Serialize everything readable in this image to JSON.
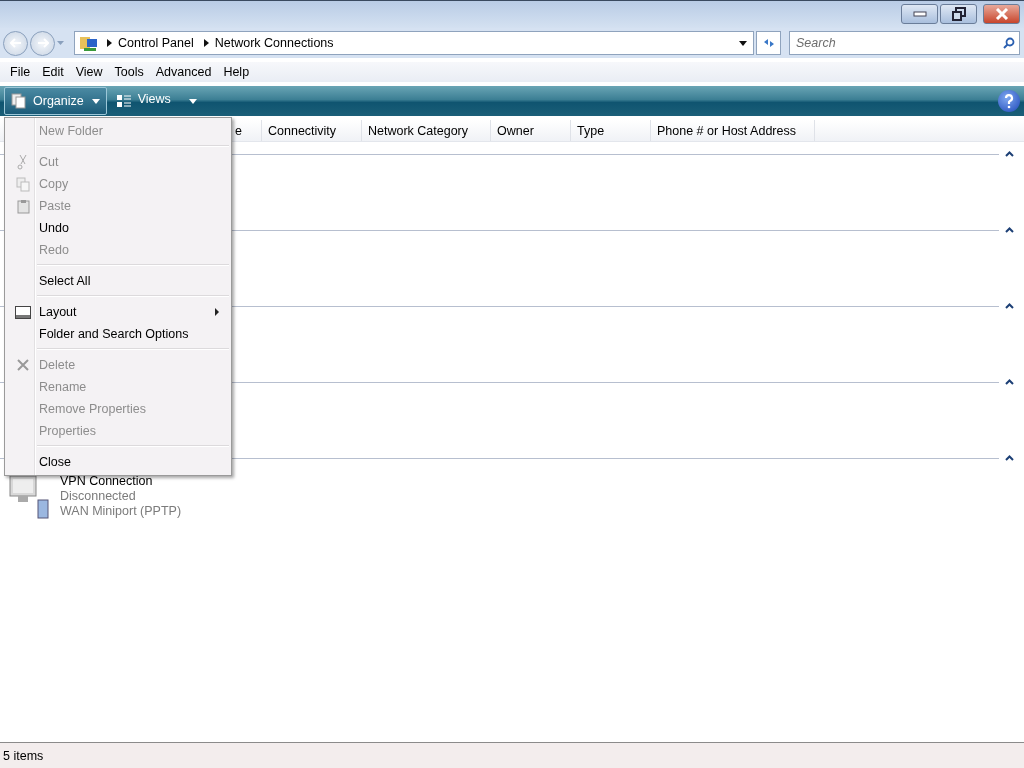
{
  "address": {
    "crumbs": [
      "Control Panel",
      "Network Connections"
    ]
  },
  "search": {
    "placeholder": "Search"
  },
  "menu_bar": [
    "File",
    "Edit",
    "View",
    "Tools",
    "Advanced",
    "Help"
  ],
  "toolbar": {
    "buttons": [
      {
        "label": "Organize",
        "selected": true
      },
      {
        "label": "Views",
        "selected": false
      }
    ]
  },
  "columns": [
    "e",
    "Connectivity",
    "Network Category",
    "Owner",
    "Type",
    "Phone # or Host Address"
  ],
  "groups": [
    {
      "expanded": true
    },
    {
      "expanded": true
    },
    {
      "expanded": true
    },
    {
      "expanded": true
    },
    {
      "expanded": true,
      "items": [
        {
          "name": "VPN Connection",
          "status": "Disconnected",
          "device": "WAN Miniport (PPTP)"
        }
      ]
    }
  ],
  "organize_menu": [
    {
      "kind": "item",
      "label": "New Folder",
      "disabled": true
    },
    {
      "kind": "separator"
    },
    {
      "kind": "item",
      "label": "Cut",
      "disabled": true
    },
    {
      "kind": "item",
      "label": "Copy",
      "disabled": true
    },
    {
      "kind": "item",
      "label": "Paste",
      "disabled": true
    },
    {
      "kind": "item",
      "label": "Undo",
      "disabled": false
    },
    {
      "kind": "item",
      "label": "Redo",
      "disabled": true
    },
    {
      "kind": "separator"
    },
    {
      "kind": "item",
      "label": "Select All",
      "disabled": false
    },
    {
      "kind": "separator"
    },
    {
      "kind": "submenu",
      "label": "Layout",
      "disabled": false
    },
    {
      "kind": "item",
      "label": "Folder and Search Options",
      "disabled": false
    },
    {
      "kind": "separator"
    },
    {
      "kind": "item",
      "label": "Delete",
      "disabled": true
    },
    {
      "kind": "item",
      "label": "Rename",
      "disabled": true
    },
    {
      "kind": "item",
      "label": "Remove Properties",
      "disabled": true
    },
    {
      "kind": "item",
      "label": "Properties",
      "disabled": true
    },
    {
      "kind": "separator"
    },
    {
      "kind": "item",
      "label": "Close",
      "disabled": false
    }
  ],
  "status_bar": {
    "text": "5 items"
  }
}
